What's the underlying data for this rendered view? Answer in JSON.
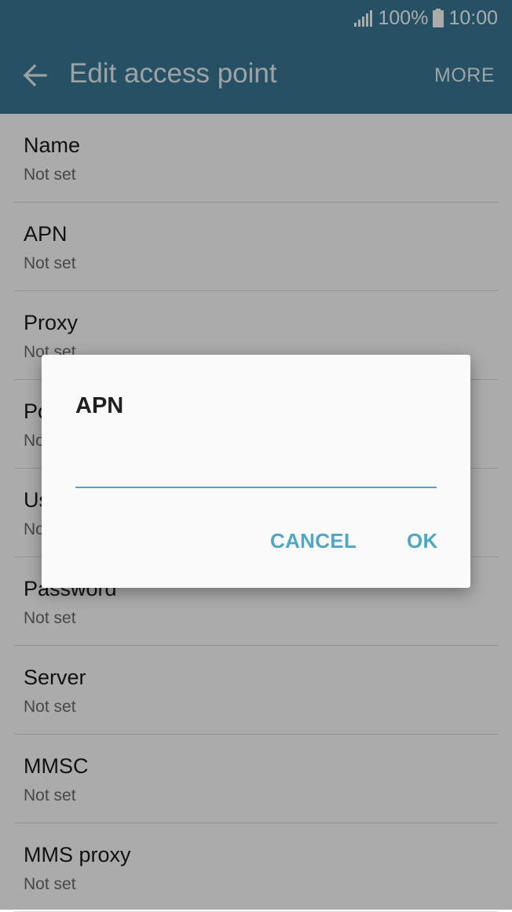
{
  "status_bar": {
    "battery_percent": "100%",
    "time": "10:00"
  },
  "app_bar": {
    "title": "Edit access point",
    "more_label": "MORE"
  },
  "list": {
    "items": [
      {
        "title": "Name",
        "value": "Not set"
      },
      {
        "title": "APN",
        "value": "Not set"
      },
      {
        "title": "Proxy",
        "value": "Not set"
      },
      {
        "title": "Port",
        "value": "Not set"
      },
      {
        "title": "Username",
        "value": "Not set"
      },
      {
        "title": "Password",
        "value": "Not set"
      },
      {
        "title": "Server",
        "value": "Not set"
      },
      {
        "title": "MMSC",
        "value": "Not set"
      },
      {
        "title": "MMS proxy",
        "value": "Not set"
      }
    ]
  },
  "dialog": {
    "title": "APN",
    "input_value": "",
    "cancel_label": "CANCEL",
    "ok_label": "OK"
  },
  "colors": {
    "app_bar": "#397a96",
    "accent": "#4fa6c6"
  },
  "icons": {
    "back": "arrow-left-icon",
    "signal": "signal-icon",
    "battery": "battery-icon"
  }
}
